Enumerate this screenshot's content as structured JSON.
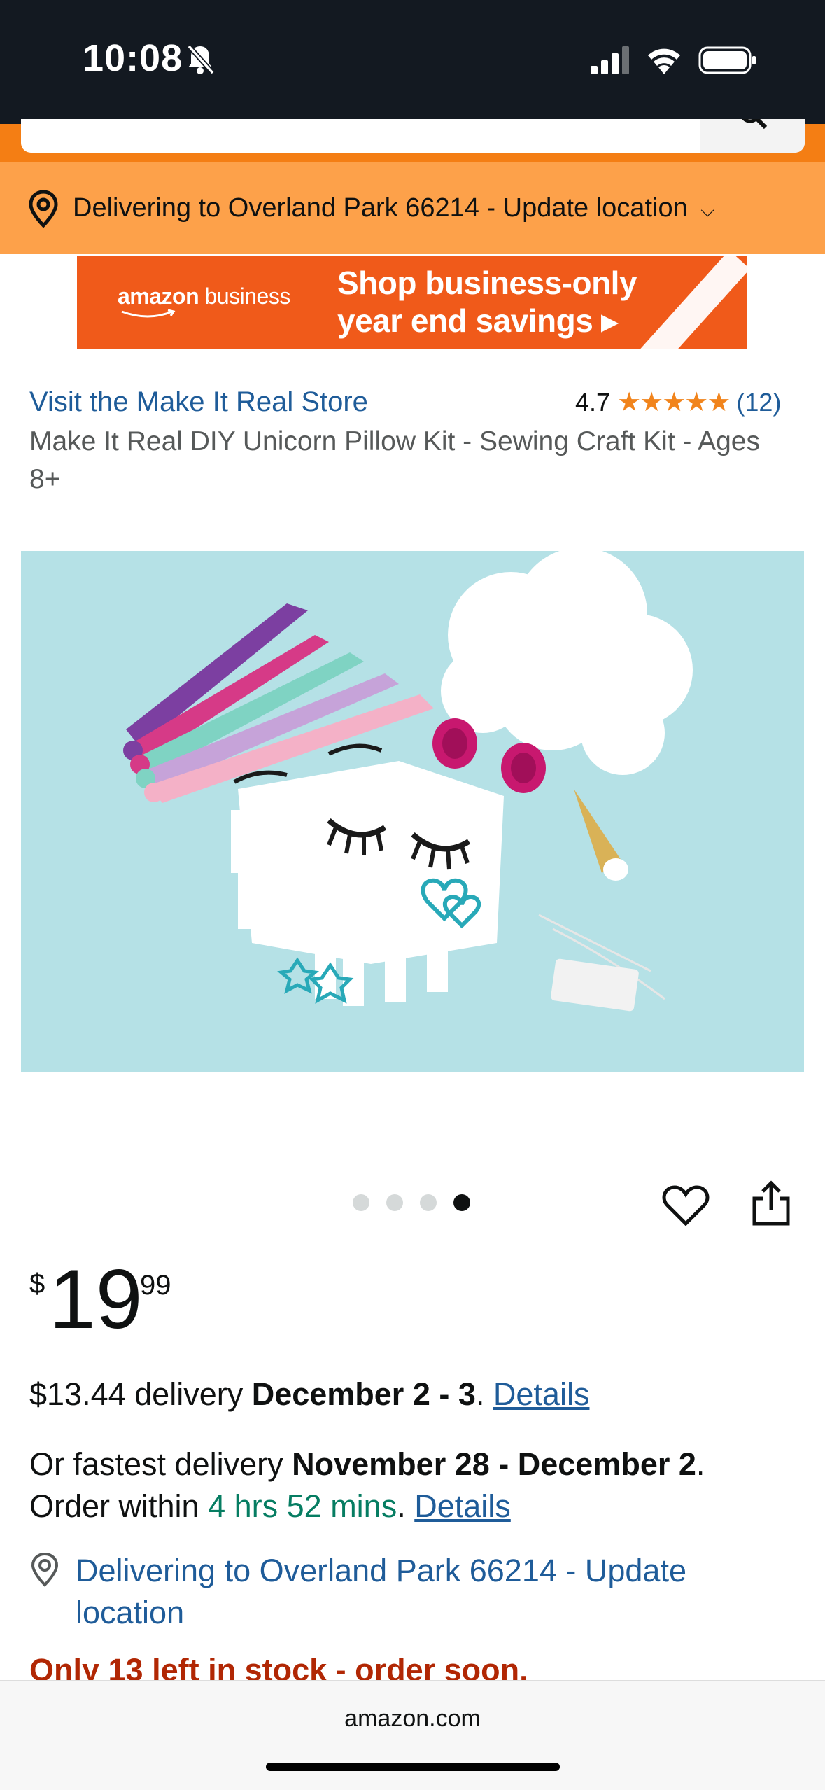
{
  "status_bar": {
    "time": "10:08",
    "icons": [
      "bell-slash-icon",
      "signal-icon",
      "wifi-icon",
      "battery-icon"
    ]
  },
  "location_bar": {
    "text": "Delivering to Overland Park 66214 - Update location",
    "chevron": "⌵"
  },
  "ad_banner": {
    "brand_1": "amazon",
    "brand_2": " business",
    "line1": "Shop business-only",
    "line2": "year end savings ▸"
  },
  "product": {
    "store_link": "Visit the Make It Real Store",
    "rating_value": "4.7",
    "rating_stars": "★★★★★",
    "rating_count": "(12)",
    "title": "Make It Real DIY Unicorn Pillow Kit - Sewing Craft Kit - Ages 8+"
  },
  "image_carousel": {
    "count": 4,
    "active_index": 3
  },
  "price": {
    "symbol": "$",
    "whole": "19",
    "fraction": "99"
  },
  "delivery": {
    "standard_prefix": "$13.44 delivery ",
    "standard_date": "December 2 - 3",
    "standard_suffix": ". ",
    "details_label": "Details",
    "fastest_prefix": "Or fastest delivery ",
    "fastest_date": "November 28 - December 2",
    "fastest_suffix": ".",
    "order_within_prefix": "Order within ",
    "order_within_time": "4 hrs 52 mins",
    "order_within_suffix": ". ",
    "details2_label": "Details",
    "location_text": "Delivering to Overland Park 66214 - Update location"
  },
  "stock": {
    "text": "Only 13 left in stock - order soon."
  },
  "browser": {
    "url": "amazon.com"
  },
  "colors": {
    "header_dark": "#131921",
    "location_orange": "#fda14a",
    "link_blue": "#1f5c99",
    "stock_red": "#b12704",
    "rating_star": "#f1841c"
  }
}
